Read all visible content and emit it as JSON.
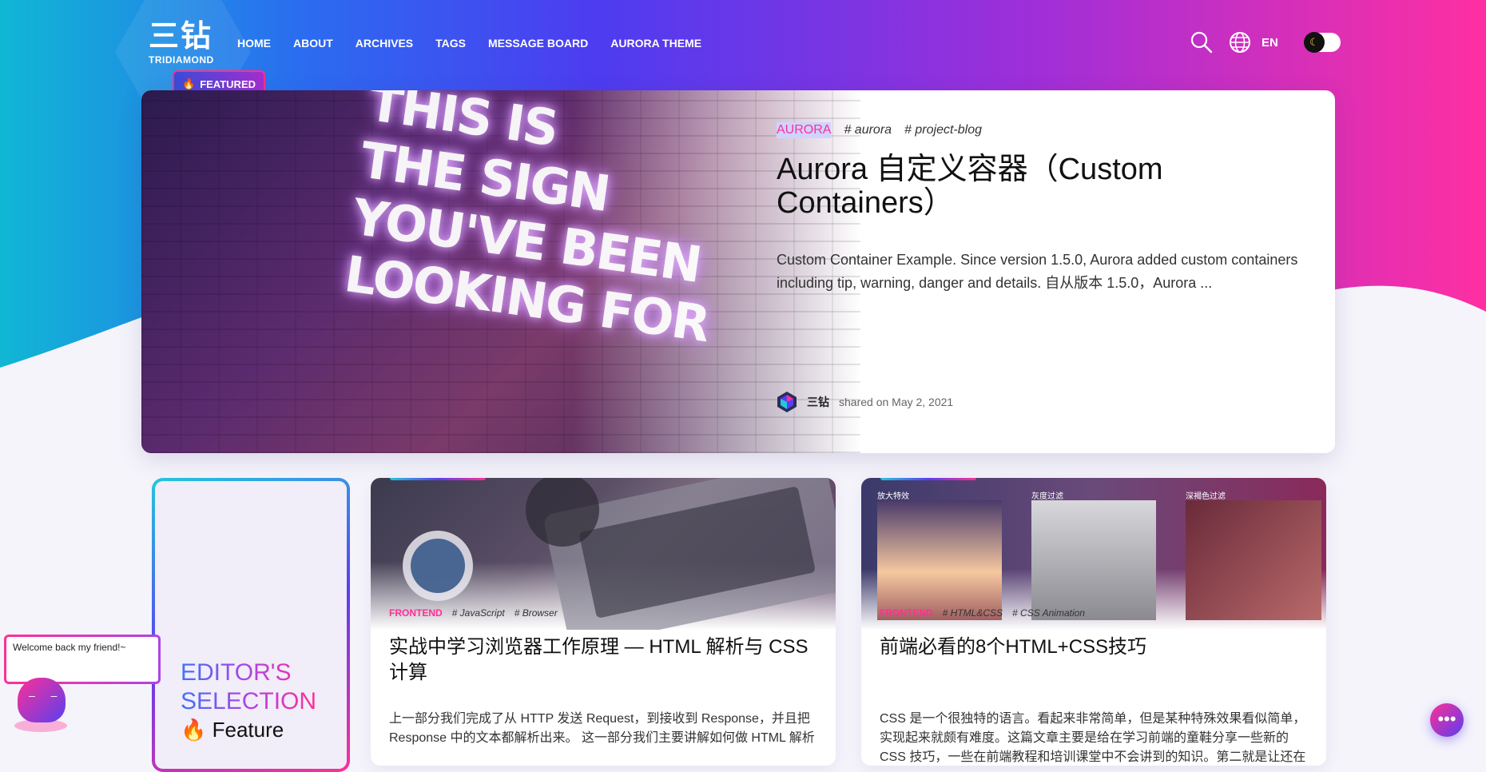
{
  "header": {
    "logo_cn": "三钻",
    "logo_en": "TRIDIAMOND",
    "nav": [
      "HOME",
      "ABOUT",
      "ARCHIVES",
      "TAGS",
      "MESSAGE BOARD",
      "AURORA THEME"
    ],
    "language": "EN"
  },
  "featured": {
    "badge": "FEATURED",
    "image_text": "THIS IS\nTHE SIGN\nYOU'VE BEEN\nLOOKING FOR",
    "category": "AURORA",
    "tags": [
      "# aurora",
      "# project-blog"
    ],
    "title": "Aurora 自定义容器（Custom Containers）",
    "description": "Custom Container Example. Since version 1.5.0, Aurora added custom containers including tip, warning, danger and details. 自从版本 1.5.0，Aurora ...",
    "author": "三钻",
    "shared_on": "shared on May 2, 2021"
  },
  "editor": {
    "title_line1": "EDITOR'S",
    "title_line2": "SELECTION",
    "sub": "Feature"
  },
  "posts": [
    {
      "category": "FRONTEND",
      "tags": [
        "# JavaScript",
        "# Browser"
      ],
      "title": "实战中学习浏览器工作原理 — HTML 解析与 CSS 计算",
      "excerpt": "上一部分我们完成了从 HTTP 发送 Request，到接收到 Response，并且把 Response 中的文本都解析出来。 这一部分我们主要讲解如何做 HTML 解析"
    },
    {
      "category": "FRONTEND",
      "tags": [
        "# HTML&CSS",
        "# CSS Animation"
      ],
      "title": "前端必看的8个HTML+CSS技巧",
      "thumb_labels": [
        "放大特效",
        "灰度过滤",
        "深褐色过滤"
      ],
      "excerpt": "CSS 是一个很独特的语言。看起来非常简单，但是某种特殊效果看似简单，实现起来就颇有难度。这篇文章主要是给在学习前端的童鞋分享一些新的 CSS 技巧，一些在前端教程和培训课堂中不会讲到的知识。第二就是让还在前端开发这条道路上的童鞋们，重新燃起对前端排版和特效的热爱和热情！"
    }
  ],
  "widgets": {
    "welcome": "Welcome back my friend!~"
  }
}
